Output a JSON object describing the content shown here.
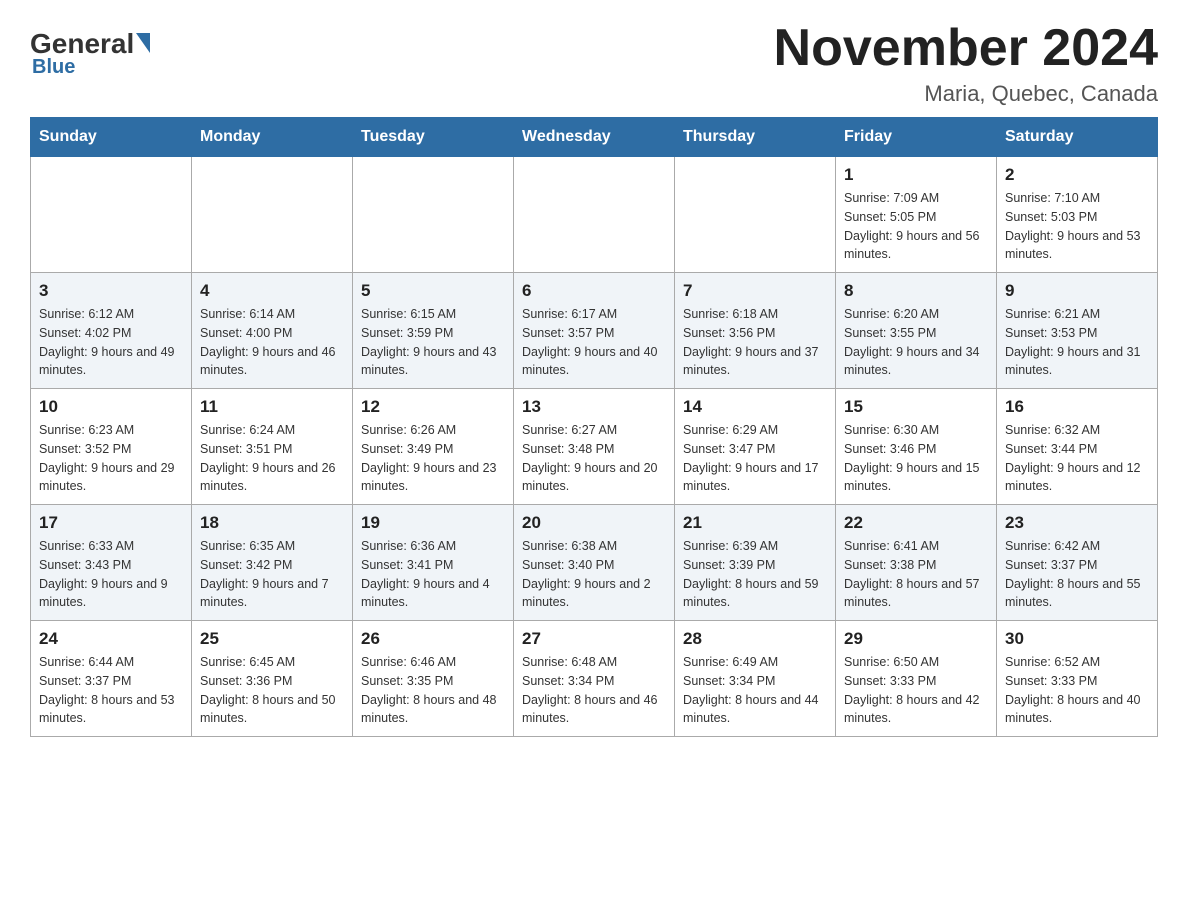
{
  "header": {
    "logo_general": "General",
    "logo_blue": "Blue",
    "title": "November 2024",
    "subtitle": "Maria, Quebec, Canada"
  },
  "days_of_week": [
    "Sunday",
    "Monday",
    "Tuesday",
    "Wednesday",
    "Thursday",
    "Friday",
    "Saturday"
  ],
  "weeks": [
    {
      "days": [
        {
          "number": "",
          "info": "",
          "empty": true
        },
        {
          "number": "",
          "info": "",
          "empty": true
        },
        {
          "number": "",
          "info": "",
          "empty": true
        },
        {
          "number": "",
          "info": "",
          "empty": true
        },
        {
          "number": "",
          "info": "",
          "empty": true
        },
        {
          "number": "1",
          "info": "Sunrise: 7:09 AM\nSunset: 5:05 PM\nDaylight: 9 hours and 56 minutes."
        },
        {
          "number": "2",
          "info": "Sunrise: 7:10 AM\nSunset: 5:03 PM\nDaylight: 9 hours and 53 minutes."
        }
      ]
    },
    {
      "days": [
        {
          "number": "3",
          "info": "Sunrise: 6:12 AM\nSunset: 4:02 PM\nDaylight: 9 hours and 49 minutes."
        },
        {
          "number": "4",
          "info": "Sunrise: 6:14 AM\nSunset: 4:00 PM\nDaylight: 9 hours and 46 minutes."
        },
        {
          "number": "5",
          "info": "Sunrise: 6:15 AM\nSunset: 3:59 PM\nDaylight: 9 hours and 43 minutes."
        },
        {
          "number": "6",
          "info": "Sunrise: 6:17 AM\nSunset: 3:57 PM\nDaylight: 9 hours and 40 minutes."
        },
        {
          "number": "7",
          "info": "Sunrise: 6:18 AM\nSunset: 3:56 PM\nDaylight: 9 hours and 37 minutes."
        },
        {
          "number": "8",
          "info": "Sunrise: 6:20 AM\nSunset: 3:55 PM\nDaylight: 9 hours and 34 minutes."
        },
        {
          "number": "9",
          "info": "Sunrise: 6:21 AM\nSunset: 3:53 PM\nDaylight: 9 hours and 31 minutes."
        }
      ]
    },
    {
      "days": [
        {
          "number": "10",
          "info": "Sunrise: 6:23 AM\nSunset: 3:52 PM\nDaylight: 9 hours and 29 minutes."
        },
        {
          "number": "11",
          "info": "Sunrise: 6:24 AM\nSunset: 3:51 PM\nDaylight: 9 hours and 26 minutes."
        },
        {
          "number": "12",
          "info": "Sunrise: 6:26 AM\nSunset: 3:49 PM\nDaylight: 9 hours and 23 minutes."
        },
        {
          "number": "13",
          "info": "Sunrise: 6:27 AM\nSunset: 3:48 PM\nDaylight: 9 hours and 20 minutes."
        },
        {
          "number": "14",
          "info": "Sunrise: 6:29 AM\nSunset: 3:47 PM\nDaylight: 9 hours and 17 minutes."
        },
        {
          "number": "15",
          "info": "Sunrise: 6:30 AM\nSunset: 3:46 PM\nDaylight: 9 hours and 15 minutes."
        },
        {
          "number": "16",
          "info": "Sunrise: 6:32 AM\nSunset: 3:44 PM\nDaylight: 9 hours and 12 minutes."
        }
      ]
    },
    {
      "days": [
        {
          "number": "17",
          "info": "Sunrise: 6:33 AM\nSunset: 3:43 PM\nDaylight: 9 hours and 9 minutes."
        },
        {
          "number": "18",
          "info": "Sunrise: 6:35 AM\nSunset: 3:42 PM\nDaylight: 9 hours and 7 minutes."
        },
        {
          "number": "19",
          "info": "Sunrise: 6:36 AM\nSunset: 3:41 PM\nDaylight: 9 hours and 4 minutes."
        },
        {
          "number": "20",
          "info": "Sunrise: 6:38 AM\nSunset: 3:40 PM\nDaylight: 9 hours and 2 minutes."
        },
        {
          "number": "21",
          "info": "Sunrise: 6:39 AM\nSunset: 3:39 PM\nDaylight: 8 hours and 59 minutes."
        },
        {
          "number": "22",
          "info": "Sunrise: 6:41 AM\nSunset: 3:38 PM\nDaylight: 8 hours and 57 minutes."
        },
        {
          "number": "23",
          "info": "Sunrise: 6:42 AM\nSunset: 3:37 PM\nDaylight: 8 hours and 55 minutes."
        }
      ]
    },
    {
      "days": [
        {
          "number": "24",
          "info": "Sunrise: 6:44 AM\nSunset: 3:37 PM\nDaylight: 8 hours and 53 minutes."
        },
        {
          "number": "25",
          "info": "Sunrise: 6:45 AM\nSunset: 3:36 PM\nDaylight: 8 hours and 50 minutes."
        },
        {
          "number": "26",
          "info": "Sunrise: 6:46 AM\nSunset: 3:35 PM\nDaylight: 8 hours and 48 minutes."
        },
        {
          "number": "27",
          "info": "Sunrise: 6:48 AM\nSunset: 3:34 PM\nDaylight: 8 hours and 46 minutes."
        },
        {
          "number": "28",
          "info": "Sunrise: 6:49 AM\nSunset: 3:34 PM\nDaylight: 8 hours and 44 minutes."
        },
        {
          "number": "29",
          "info": "Sunrise: 6:50 AM\nSunset: 3:33 PM\nDaylight: 8 hours and 42 minutes."
        },
        {
          "number": "30",
          "info": "Sunrise: 6:52 AM\nSunset: 3:33 PM\nDaylight: 8 hours and 40 minutes."
        }
      ]
    }
  ]
}
